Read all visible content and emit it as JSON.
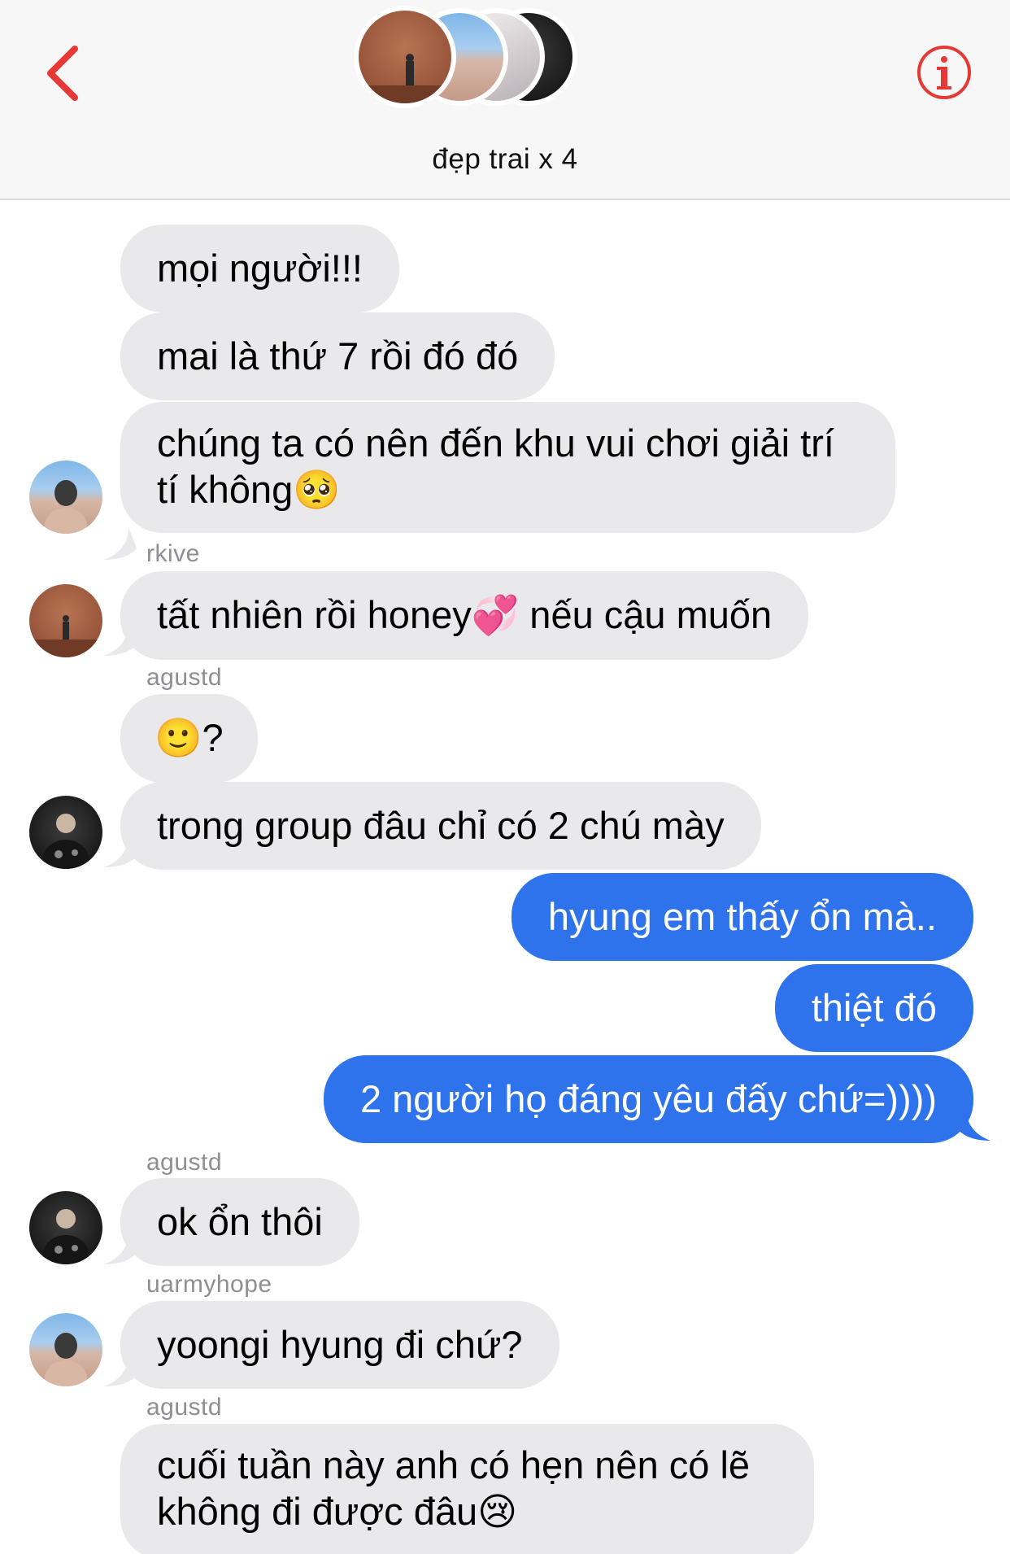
{
  "header": {
    "group_name": "đẹp trai x 4",
    "back_icon": "chevron-left-icon",
    "info_icon": "info-icon",
    "accent_color": "#e53935"
  },
  "messages": [
    {
      "direction": "in",
      "text": "mọi người!!!"
    },
    {
      "direction": "in",
      "text": "mai là thứ 7 rồi đó đó"
    },
    {
      "direction": "in",
      "text": "chúng ta có nên đến khu vui chơi giải trí tí không",
      "emoji": "🥺"
    },
    {
      "sender": "rkive"
    },
    {
      "direction": "in",
      "text": "tất nhiên rồi honey",
      "emoji": "💞",
      "text_after": " nếu cậu muốn"
    },
    {
      "sender": "agustd"
    },
    {
      "direction": "in",
      "emoji": "🙂",
      "text": "?"
    },
    {
      "direction": "in",
      "text": "trong group đâu chỉ có 2 chú mày"
    },
    {
      "direction": "out",
      "text": "hyung em thấy ổn mà.."
    },
    {
      "direction": "out",
      "text": "thiệt đó"
    },
    {
      "direction": "out",
      "text": "2 người họ đáng yêu đấy chứ=))))"
    },
    {
      "sender": "agustd"
    },
    {
      "direction": "in",
      "text": "ok ổn thôi"
    },
    {
      "sender": "uarmyhope"
    },
    {
      "direction": "in",
      "text": "yoongi hyung đi chứ?"
    },
    {
      "sender": "agustd"
    },
    {
      "direction": "in",
      "text": "cuối tuần này anh có hẹn nên có lẽ không đi được đâu",
      "emoji": "😢"
    }
  ],
  "colors": {
    "incoming_bubble": "#e9e9eb",
    "outgoing_bubble": "#2f73ec",
    "sender_label": "#8e8e93",
    "header_bg": "#f7f7f7"
  }
}
